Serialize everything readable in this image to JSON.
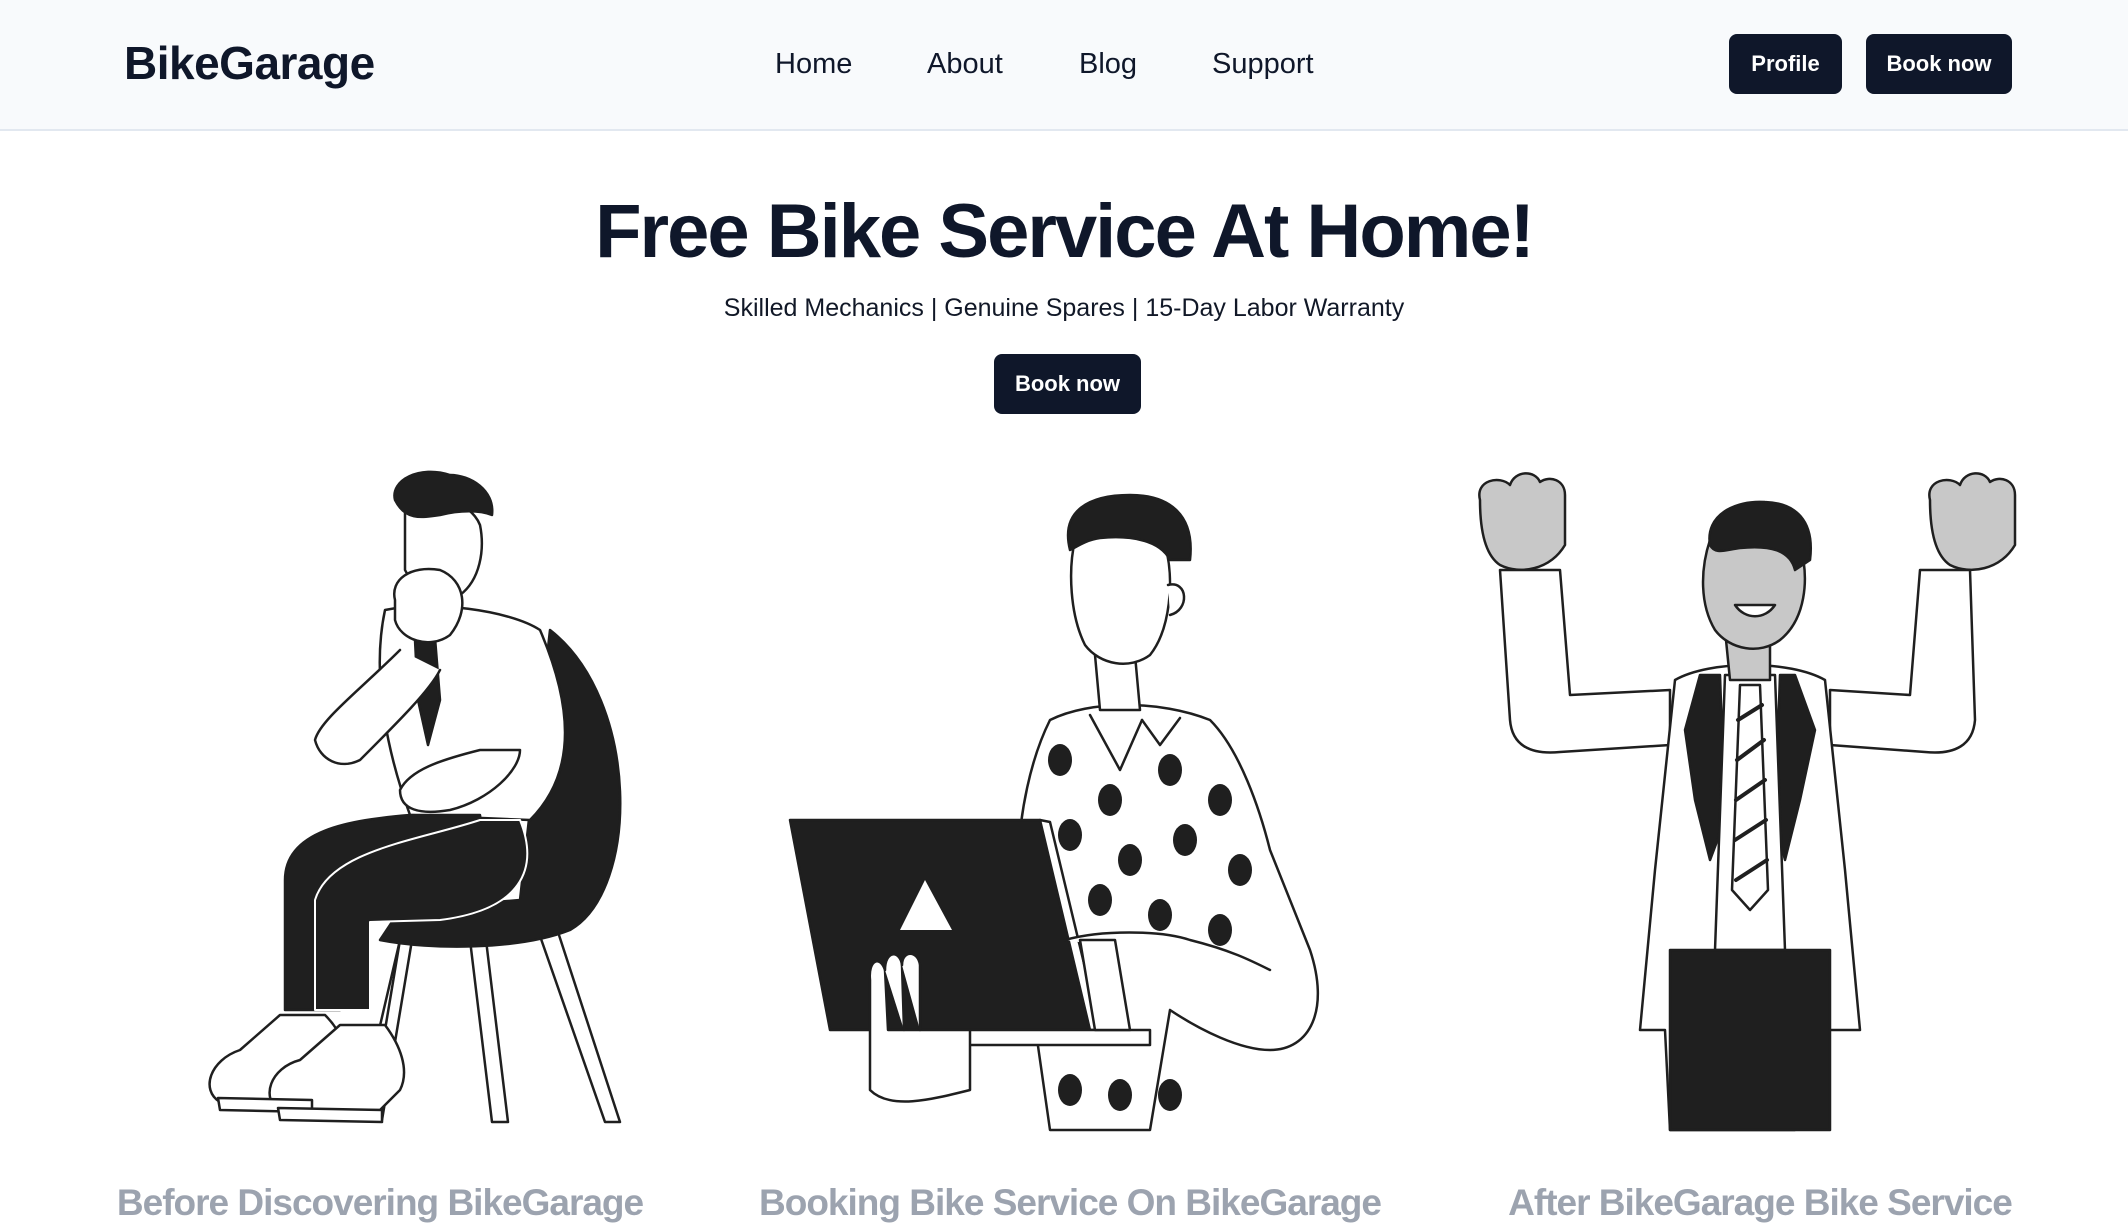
{
  "header": {
    "logo": "BikeGarage",
    "nav": [
      "Home",
      "About",
      "Blog",
      "Support"
    ],
    "profile_label": "Profile",
    "book_label": "Book now"
  },
  "hero": {
    "title": "Free Bike Service At Home!",
    "subtitle": "Skilled Mechanics | Genuine Spares | 15-Day Labor Warranty",
    "cta_label": "Book now"
  },
  "steps": [
    {
      "caption": "Before Discovering BikeGarage",
      "illustration": "thinking-man-on-chair"
    },
    {
      "caption": "Booking Bike Service On BikeGarage",
      "illustration": "man-using-laptop"
    },
    {
      "caption": "After BikeGarage Bike Service",
      "illustration": "celebrating-man"
    }
  ],
  "colors": {
    "primary": "#0f172a",
    "header_bg": "#f8fafc",
    "caption": "#9ca3af",
    "illustration_fill": "#1f1f1f",
    "illustration_gray": "#c8c8c8"
  }
}
